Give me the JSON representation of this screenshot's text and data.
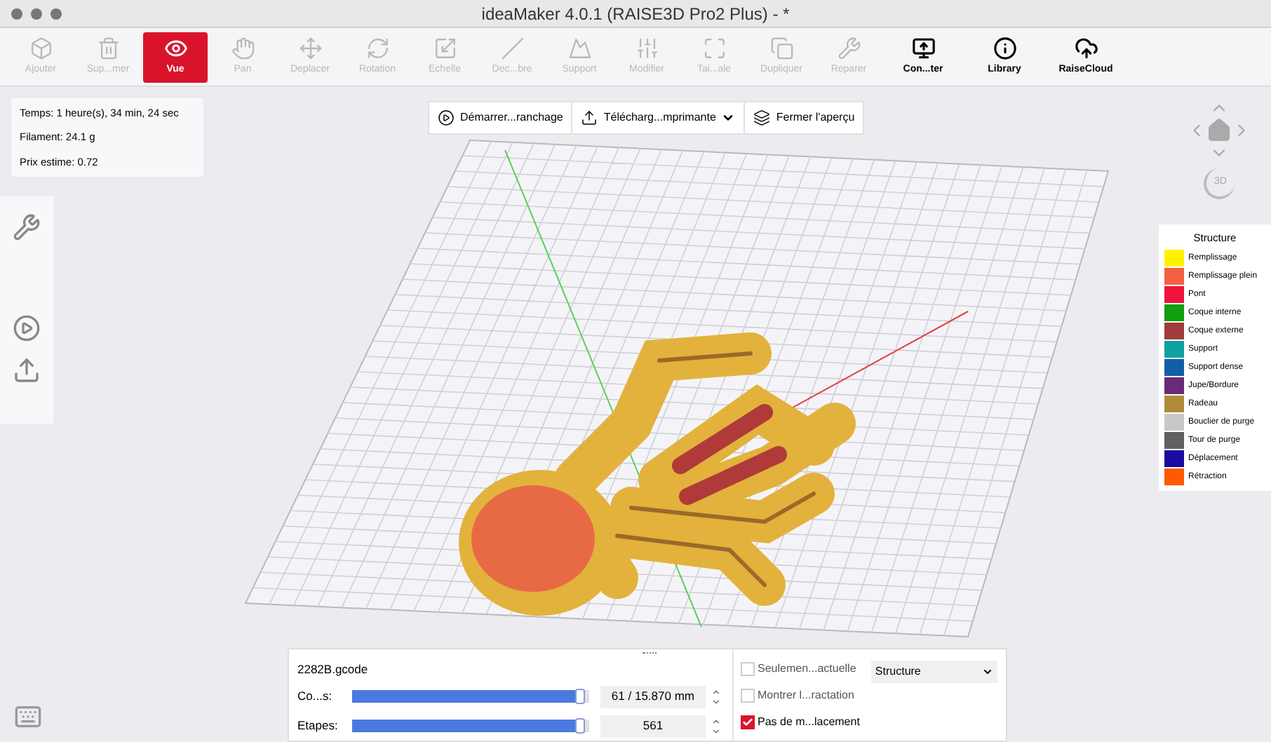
{
  "window": {
    "title": "ideaMaker 4.0.1 (RAISE3D Pro2 Plus) - *"
  },
  "toolbar": [
    {
      "label": "Ajouter",
      "selected": false,
      "disabled": true
    },
    {
      "label": "Sup...mer",
      "selected": false,
      "disabled": true
    },
    {
      "label": "Vue",
      "selected": true,
      "disabled": false
    },
    {
      "label": "Pan",
      "selected": false,
      "disabled": true
    },
    {
      "label": "Deplacer",
      "selected": false,
      "disabled": true
    },
    {
      "label": "Rotation",
      "selected": false,
      "disabled": true
    },
    {
      "label": "Echelle",
      "selected": false,
      "disabled": true
    },
    {
      "label": "Dec...bre",
      "selected": false,
      "disabled": true
    },
    {
      "label": "Support",
      "selected": false,
      "disabled": true
    },
    {
      "label": "Modifier",
      "selected": false,
      "disabled": true
    },
    {
      "label": "Tai...ale",
      "selected": false,
      "disabled": true
    },
    {
      "label": "Dupliquer",
      "selected": false,
      "disabled": true
    },
    {
      "label": "Reparer",
      "selected": false,
      "disabled": true
    },
    {
      "label": "Con...ter",
      "selected": false,
      "disabled": false
    },
    {
      "label": "Library",
      "selected": false,
      "disabled": false
    },
    {
      "label": "RaiseCloud",
      "selected": false,
      "disabled": false
    }
  ],
  "info": [
    "Temps: 1 heure(s), 34 min, 24 sec",
    "Filament: 24.1 g",
    "Prix estime: 0.72"
  ],
  "actions": [
    {
      "label": "Démarrer...ranchage",
      "dropdown": false
    },
    {
      "label": "Télécharg...mprimante",
      "dropdown": true
    },
    {
      "label": "Fermer l'aperçu",
      "dropdown": false
    }
  ],
  "view_cube": {
    "label": "3D"
  },
  "legend": {
    "title": "Structure",
    "items": [
      {
        "label": "Remplissage",
        "color": "#fff200"
      },
      {
        "label": "Remplissage plein",
        "color": "#f26040"
      },
      {
        "label": "Pont",
        "color": "#f0143c"
      },
      {
        "label": "Coque interne",
        "color": "#10a010"
      },
      {
        "label": "Coque externe",
        "color": "#a03c3c"
      },
      {
        "label": "Support",
        "color": "#10a0a0"
      },
      {
        "label": "Support dense",
        "color": "#1060a8"
      },
      {
        "label": "Jupe/Bordure",
        "color": "#6a2a78"
      },
      {
        "label": "Radeau",
        "color": "#b08c3a"
      },
      {
        "label": "Bouclier de purge",
        "color": "#c8c8c8"
      },
      {
        "label": "Tour de purge",
        "color": "#606060"
      },
      {
        "label": "Déplacement",
        "color": "#1a0aa0"
      },
      {
        "label": "Rétraction",
        "color": "#ff5a00"
      }
    ]
  },
  "preview": {
    "file": "2282B.gcode",
    "sliders": [
      {
        "label": "Co...s:",
        "level": 0.98,
        "value": "61 / 15.870 mm"
      },
      {
        "label": "Etapes:",
        "level": 0.98,
        "value": "561"
      }
    ],
    "options": [
      {
        "label": "Seulemen...actuelle",
        "checked": false
      },
      {
        "label": "Montrer l...ractation",
        "checked": false
      },
      {
        "label": "Pas de m...lacement",
        "checked": true
      }
    ],
    "mode": "Structure"
  }
}
